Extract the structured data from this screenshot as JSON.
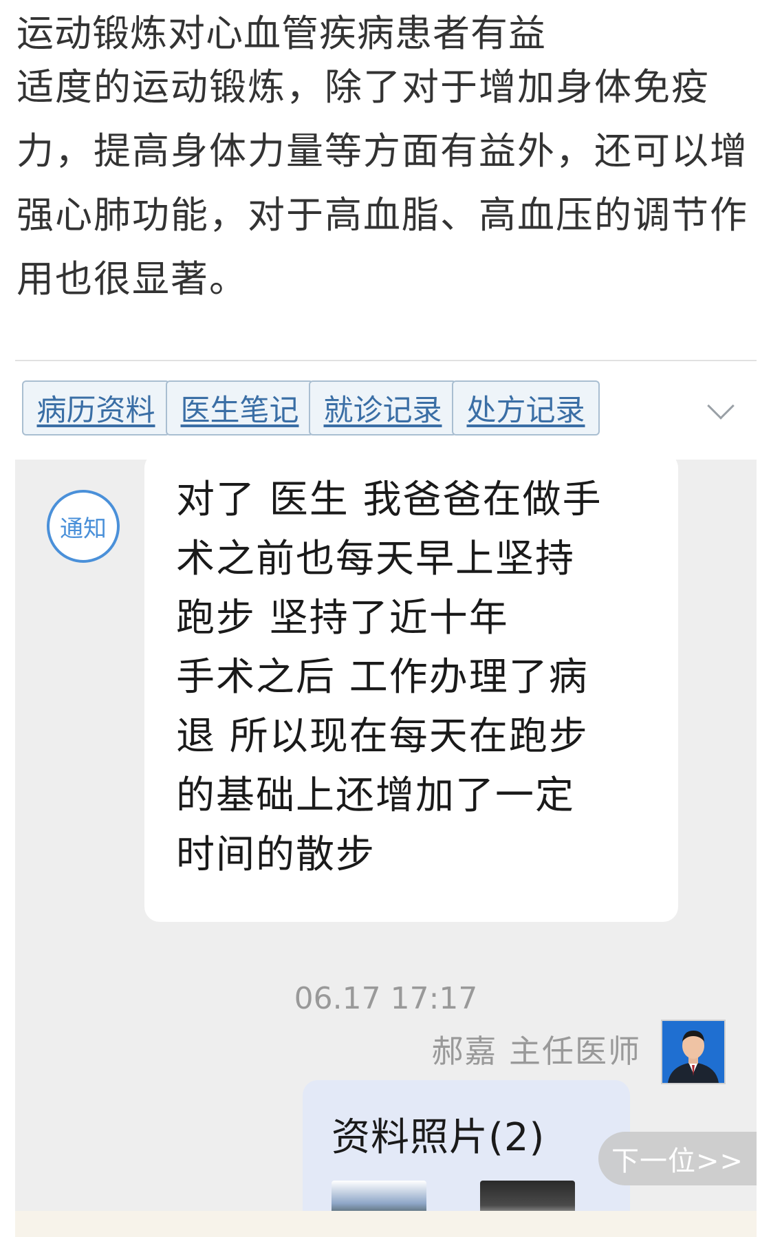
{
  "article": {
    "title": "运动锻炼对心血管疾病患者有益",
    "body": "适度的运动锻炼，除了对于增加身体免疫力，提高身体力量等方面有益外，还可以增强心肺功能，对于高血脂、高血压的调节作用也很显著。"
  },
  "tabs": [
    {
      "label": "病历资料"
    },
    {
      "label": "医生笔记"
    },
    {
      "label": "就诊记录"
    },
    {
      "label": "处方记录"
    }
  ],
  "chat": {
    "notice_label": "通知",
    "message": "对了 医生 我爸爸在做手术之前也每天早上坚持跑步 坚持了近十年 手术之后 工作办理了病退 所以现在每天在跑步的基础上还增加了一定时间的散步",
    "message_lines": [
      "对了 医生 我爸爸在做手",
      "术之前也每天早上坚持",
      "跑步 坚持了近十年",
      "手术之后 工作办理了病",
      "退 所以现在每天在跑步",
      "的基础上还增加了一定",
      "时间的散步"
    ],
    "timestamp": "06.17 17:17",
    "doctor_name": "郝嘉 主任医师",
    "photo_title": "资料照片(2)"
  },
  "next_button": "下一位>>",
  "colors": {
    "link_blue": "#3a6ea5",
    "notice_blue": "#4a90d9",
    "chat_bg": "#eeeeee"
  }
}
